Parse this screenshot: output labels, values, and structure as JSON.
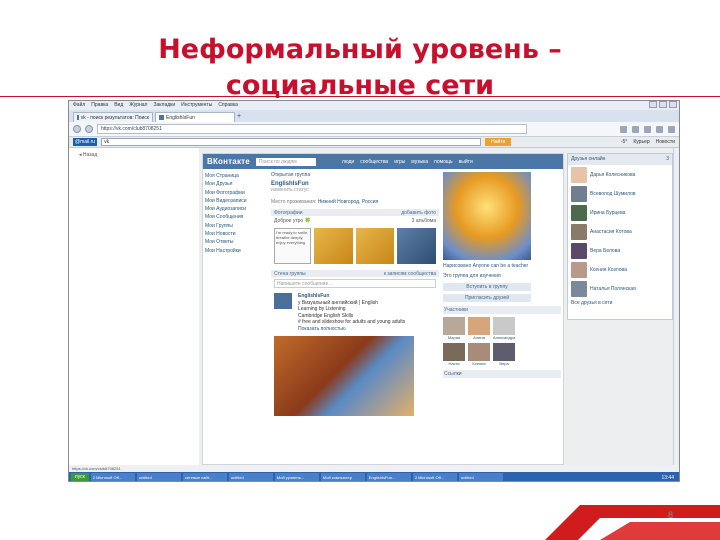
{
  "slide": {
    "title_line1": "Неформальный уровень –",
    "title_line2": "социальные сети",
    "page_number": "8",
    "accent": "#c8102e"
  },
  "browser": {
    "menu": [
      "Файл",
      "Правка",
      "Вид",
      "Журнал",
      "Закладки",
      "Инструменты",
      "Справка"
    ],
    "tabs": [
      {
        "label": "vk - поиск результатов: Поиск"
      },
      {
        "label": "EnglishIsFun"
      }
    ],
    "url": "https://vk.com/club8708251",
    "mail_logo": "@mail.ru",
    "mail_query": "vk",
    "find_label": "Найти",
    "mail_right": [
      "-5°",
      "Курьер",
      "Новости"
    ],
    "back_label": "Назад",
    "status_url": "https://vk.com/club8708251",
    "clock": "13:44"
  },
  "vk": {
    "logo": "ВКонтакте",
    "search_placeholder": "Поиск по людям",
    "top_menu": [
      "люди",
      "сообщества",
      "игры",
      "музыка",
      "помощь",
      "выйти"
    ],
    "left_menu": [
      "Моя Страница",
      "Мои Друзья",
      "Мои Фотографии",
      "Мои Видеозаписи",
      "Мои Аудиозаписи",
      "Мои Сообщения",
      "Мои Группы",
      "Мои Новости",
      "Мои Ответы",
      "Мои Настройки"
    ],
    "tabs": "Открытая группа",
    "group_name": "EnglishIsFun",
    "group_status": "изменить статус",
    "city_label": "Место проживания:",
    "city": "Нижний Новгород, Россия",
    "photos_label": "Фотографии",
    "photos_more": "добавить фото",
    "photos_sub": "Доброе утро 🍀",
    "photos_count": "3 альбома",
    "doodle_text": "I'm ready to smile, breathe deeply, enjoy everything",
    "wall_label": "Стена группы",
    "wall_right": "к записям сообщества",
    "wall_placeholder": "Напишите сообщение...",
    "post_author": "EnglishIsFun",
    "post_line1": "у Визуальный английский | English",
    "post_line2": "Learning by Listening",
    "post_line3": "Cambridge English Skills",
    "post_line4": "# free and slideshow for adults and young adults",
    "post_more": "Показать полностью",
    "right_text1": "Нарисовано Anyone can be a teacher",
    "right_text2": "Это группа для изучения",
    "join_btn": "Вступить в группу",
    "invite_btn": "Пригласить друзей",
    "members_label": "Участники",
    "members": [
      "Мария",
      "Алина",
      "Александра",
      "Настя",
      "Ксения",
      "Вера"
    ],
    "links_label": "Ссылки"
  },
  "friends": {
    "header": "Друзья онлайн",
    "count": "3",
    "items": [
      "Дарья Колесникова",
      "Всеволод Шумилов",
      "Ирина Бурцева",
      "Анастасия Котова",
      "Вера Белова",
      "Ксения Козлова",
      "Наталья Полянская"
    ],
    "more": "Все друзья в сети"
  },
  "taskbar": {
    "start": "пуск",
    "items": [
      "2 Microsoft Off...",
      "untitled",
      "сетевые сайт...",
      "untitled",
      "Мой уровень...",
      "Мой компьютер",
      "EnglishIsFun...",
      "2 Microsoft Off...",
      "untitled"
    ]
  }
}
